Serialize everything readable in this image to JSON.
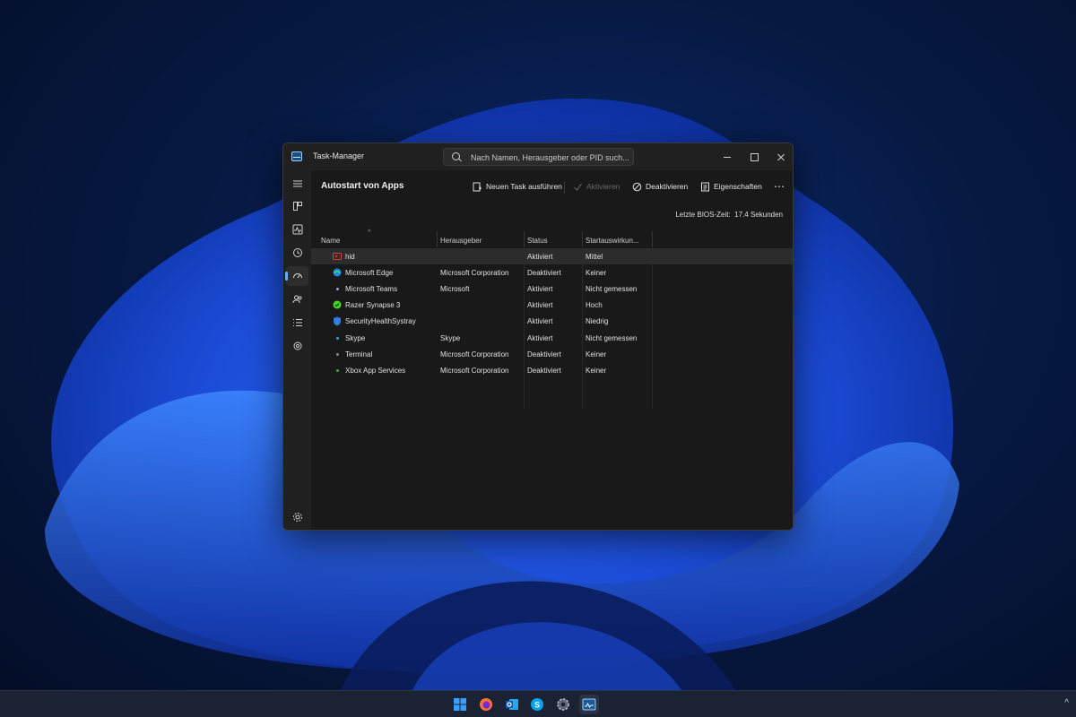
{
  "window": {
    "title": "Task-Manager",
    "search_placeholder": "Nach Namen, Herausgeber oder PID such..."
  },
  "sidebar": {
    "items": [
      {
        "icon": "hamburger-menu-icon"
      },
      {
        "icon": "processes-icon"
      },
      {
        "icon": "performance-icon"
      },
      {
        "icon": "app-history-icon"
      },
      {
        "icon": "startup-apps-icon",
        "active": true
      },
      {
        "icon": "users-icon"
      },
      {
        "icon": "details-icon"
      },
      {
        "icon": "services-icon"
      },
      {
        "icon": "settings-icon"
      }
    ]
  },
  "main": {
    "page_title": "Autostart von Apps",
    "toolbar": {
      "new_task": "Neuen Task ausführen",
      "enable": "Aktivieren",
      "disable": "Deaktivieren",
      "properties": "Eigenschaften",
      "more": "⋯"
    },
    "bios_label": "Letzte BIOS-Zeit:",
    "bios_value": "17.4 Sekunden",
    "columns": {
      "name": "Name",
      "publisher": "Herausgeber",
      "status": "Status",
      "impact": "Startauswirkun..."
    },
    "rows": [
      {
        "name": "hid",
        "publisher": "",
        "status": "Aktiviert",
        "impact": "Mittel",
        "icon": "hid-app-icon",
        "color": "#d32f2f",
        "selected": true
      },
      {
        "name": "Microsoft Edge",
        "publisher": "Microsoft Corporation",
        "status": "Deaktiviert",
        "impact": "Keiner",
        "icon": "edge-icon",
        "color": "#2aa0e8"
      },
      {
        "name": "Microsoft Teams",
        "publisher": "Microsoft",
        "status": "Aktiviert",
        "impact": "Nicht gemessen",
        "icon": "teams-icon",
        "color": "#7b83eb"
      },
      {
        "name": "Razer Synapse 3",
        "publisher": "",
        "status": "Aktiviert",
        "impact": "Hoch",
        "icon": "razer-icon",
        "color": "#44d62c"
      },
      {
        "name": "SecurityHealthSystray",
        "publisher": "",
        "status": "Aktiviert",
        "impact": "Niedrig",
        "icon": "security-shield-icon",
        "color": "#2f7fe0"
      },
      {
        "name": "Skype",
        "publisher": "Skype",
        "status": "Aktiviert",
        "impact": "Nicht gemessen",
        "icon": "skype-icon",
        "color": "#29a8e0"
      },
      {
        "name": "Terminal",
        "publisher": "Microsoft Corporation",
        "status": "Deaktiviert",
        "impact": "Keiner",
        "icon": "terminal-icon",
        "color": "#888888"
      },
      {
        "name": "Xbox App Services",
        "publisher": "Microsoft Corporation",
        "status": "Deaktiviert",
        "impact": "Keiner",
        "icon": "xbox-icon",
        "color": "#3fae49"
      }
    ]
  },
  "taskbar": {
    "apps": [
      {
        "icon": "windows-start-icon",
        "color": "#3aa0ff"
      },
      {
        "icon": "firefox-icon",
        "color": "#ff7139"
      },
      {
        "icon": "outlook-icon",
        "color": "#1f6fc5"
      },
      {
        "icon": "skype-icon",
        "color": "#00a2ed"
      },
      {
        "icon": "settings-gear-icon",
        "color": "#9aa3b0"
      },
      {
        "icon": "task-manager-icon",
        "color": "#7fb8ea"
      }
    ],
    "tray_chevron": "^"
  }
}
